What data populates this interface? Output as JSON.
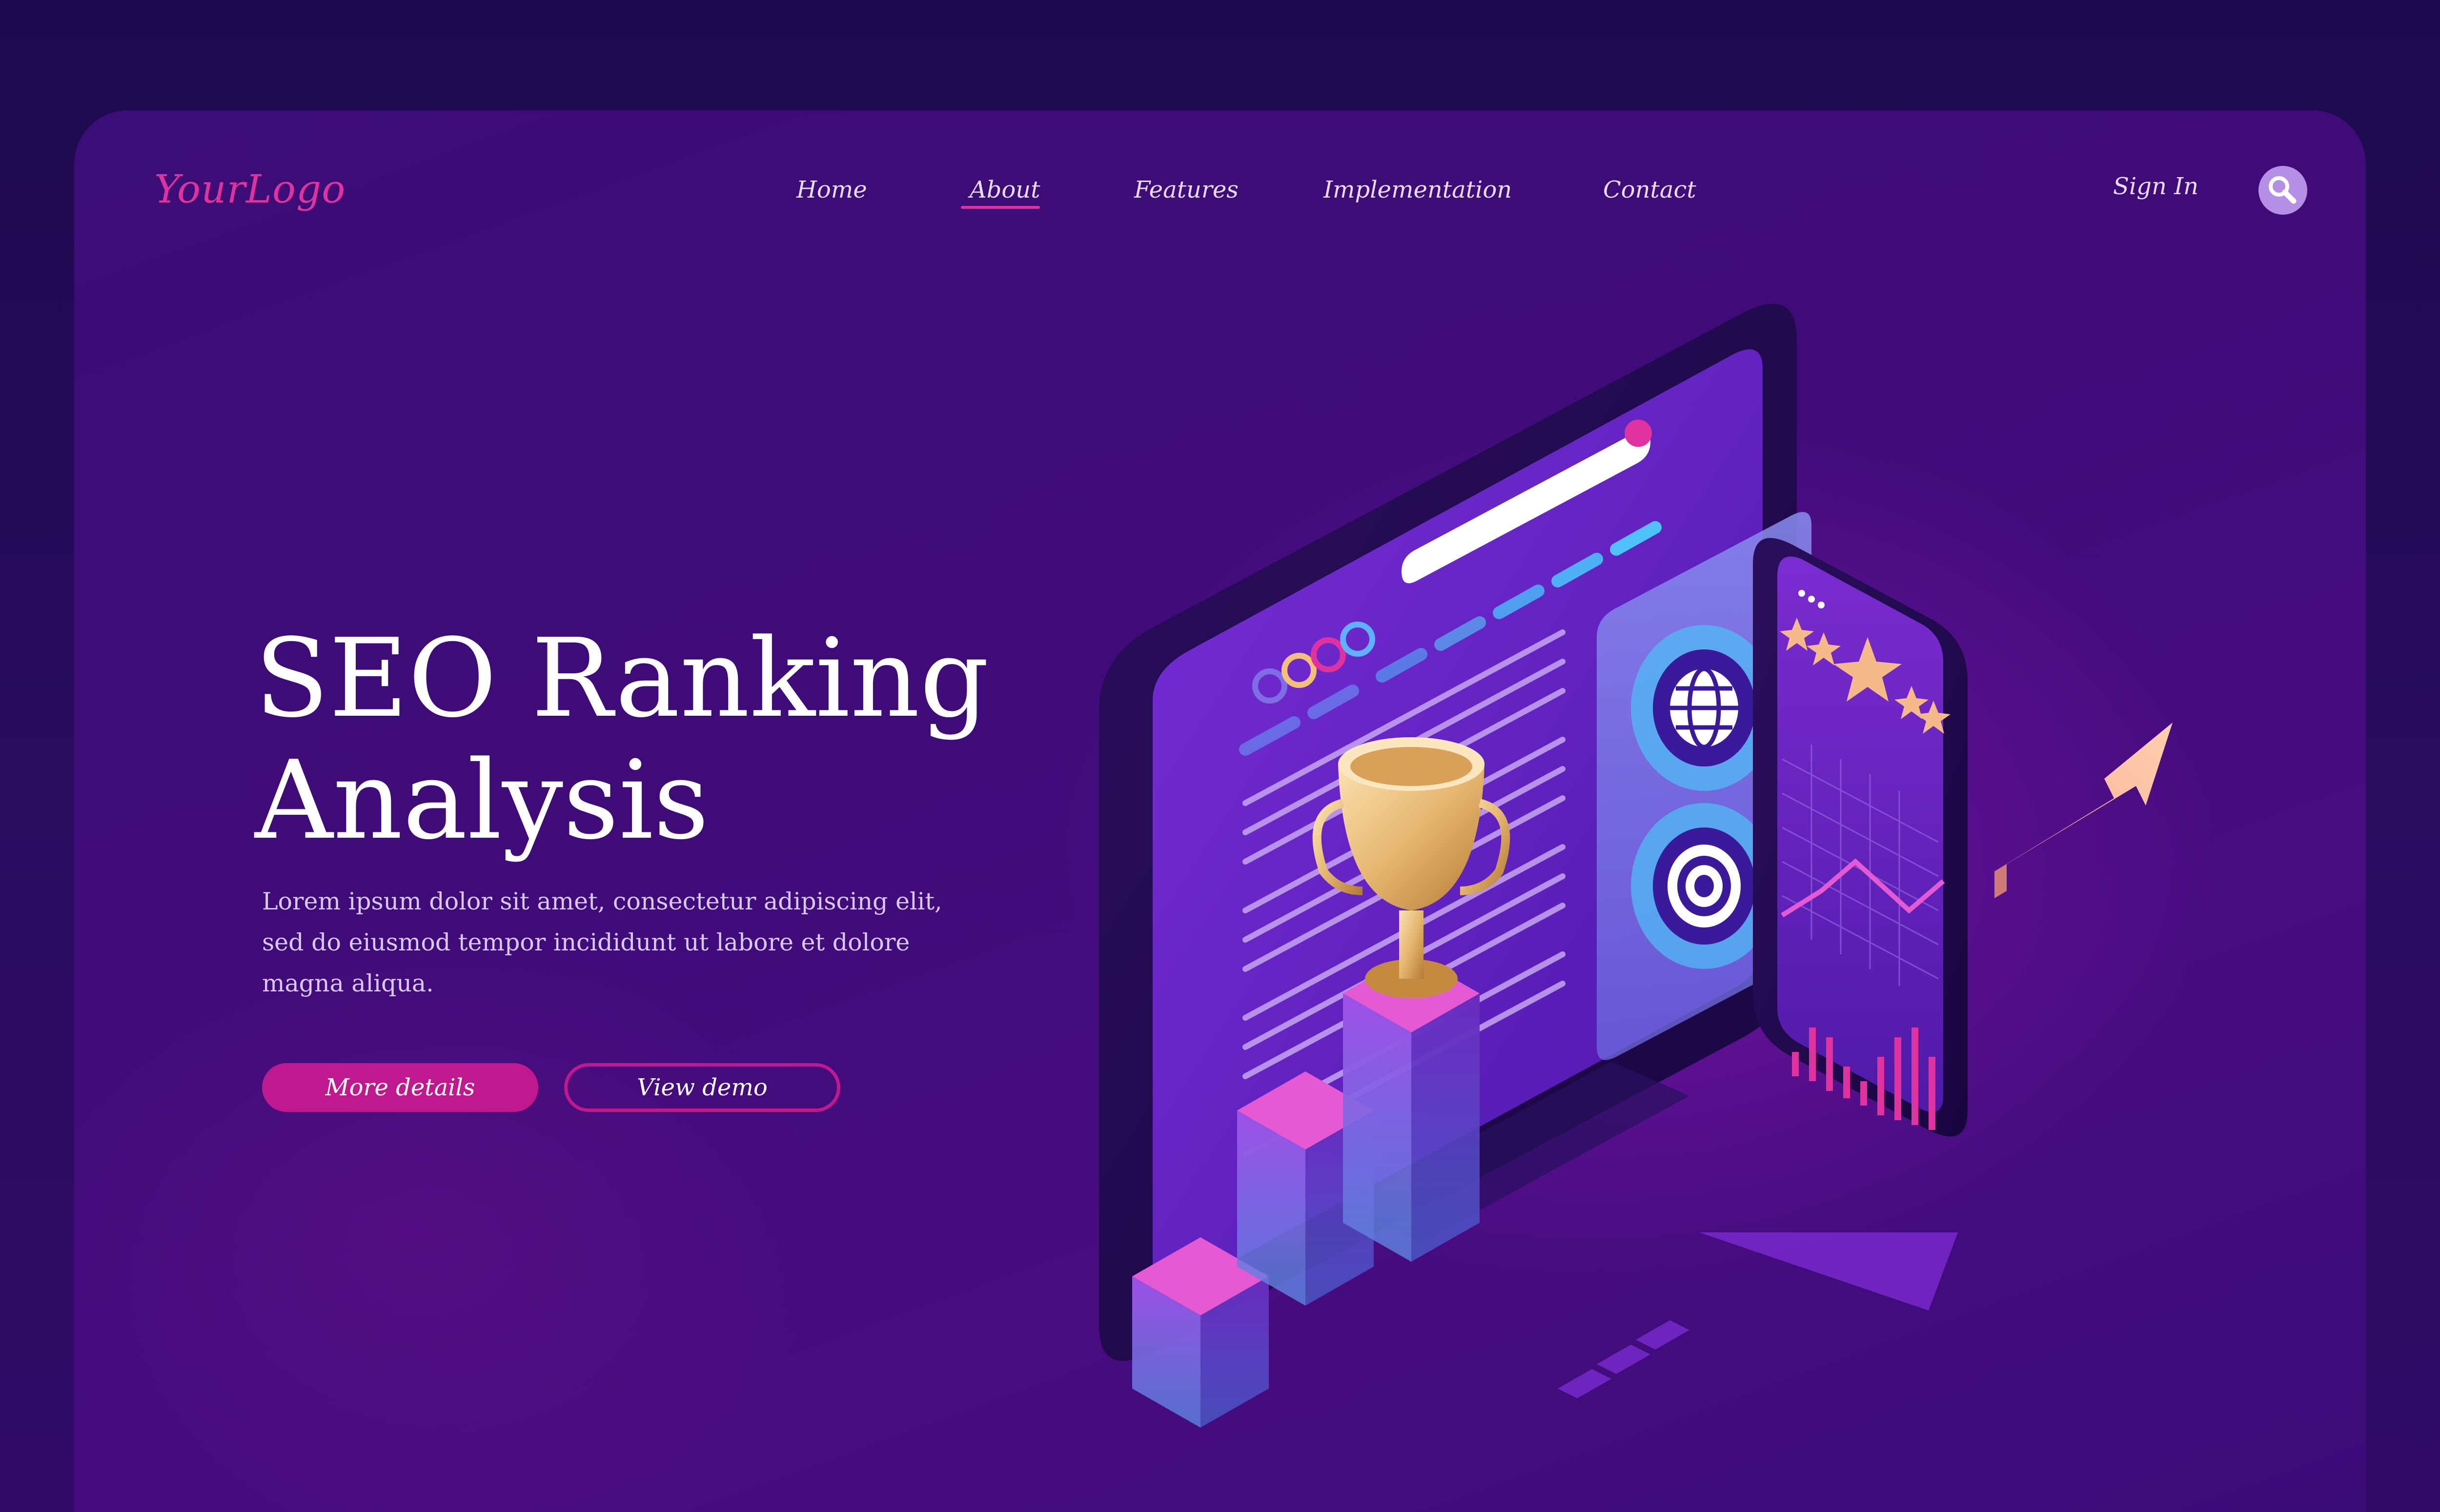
{
  "header": {
    "logo": "YourLogo",
    "nav": [
      {
        "label": "Home"
      },
      {
        "label": "About",
        "active": true
      },
      {
        "label": "Features"
      },
      {
        "label": "Implementation"
      },
      {
        "label": "Contact"
      }
    ],
    "sign_in": "Sign In",
    "search_icon": "search-icon"
  },
  "hero": {
    "title_line1": "SEO Ranking",
    "title_line2": "Analysis",
    "description_line1": "Lorem ipsum dolor sit amet, consectetur adipiscing elit,",
    "description_line2": "sed do eiusmod tempor incididunt ut labore et dolore",
    "description_line3": "magna aliqua.",
    "primary_button": "More details",
    "secondary_button": "View demo"
  },
  "illustration": {
    "icons": [
      "monitor-icon",
      "trophy-icon",
      "globe-icon",
      "target-icon",
      "smartphone-icon",
      "star-rating-icon",
      "growth-arrow-icon",
      "bar-chart-icon"
    ],
    "star_rating": 5
  },
  "colors": {
    "accent": "#e0329f",
    "button": "#c0188f",
    "background": "#3e0b78",
    "search_button": "#b58ee6"
  }
}
